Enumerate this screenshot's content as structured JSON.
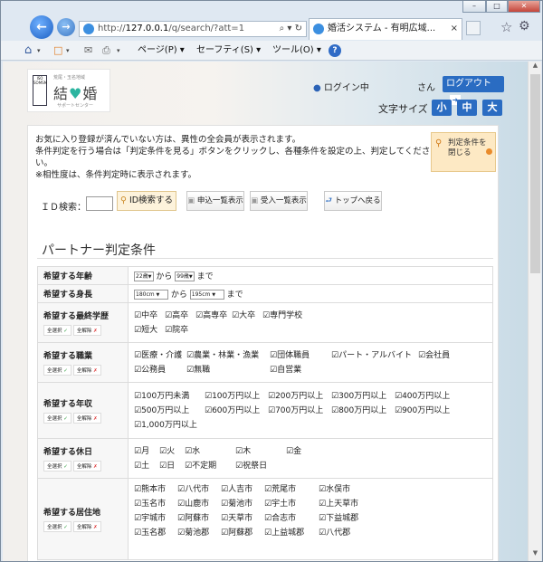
{
  "browser": {
    "url_prefix": "http://",
    "url_host": "127.0.0.1",
    "url_path": "/q/search/?att=1",
    "address_icons": "⌕ ▾ ↻",
    "tab_title": "婚活システム - 有明広域...",
    "tab_close": "×",
    "menu": {
      "page": "ページ(P) ▾",
      "safety": "セーフティ(S) ▾",
      "tools": "ツール(O) ▾",
      "help": "?"
    },
    "window_buttons": {
      "min": "–",
      "max": "□",
      "close": "✕"
    }
  },
  "header": {
    "logo_sub": "荒尾・玉名地域",
    "logo_main_a": "結",
    "logo_main_b": "婚",
    "logo_sub2": "サポートセンター",
    "logo_badge": "ISO SOMSM",
    "login_status": "ログイン中",
    "san": "さん",
    "logout": "ログアウト",
    "font_size_label": "文字サイズ",
    "font_sizes": [
      "小",
      "中",
      "大"
    ]
  },
  "notice": {
    "line1": "お気に入り登録が済んでいない方は、異性の全会員が表示されます。",
    "line2": "条件判定を行う場合は「判定条件を見る」ボタンをクリックし、各種条件を設定の上、判定してくださ",
    "line3": "い。",
    "line4": "※相性度は、条件判定時に表示されます。",
    "judge_button_l1": "判定条件を",
    "judge_button_l2": "閉じる"
  },
  "id_search": {
    "label": "ＩＤ検索：",
    "value": "",
    "search_button": "ID検索する",
    "btn_applied": "申込一覧表示",
    "btn_received": "受入一覧表示",
    "btn_top": "トップへ戻る"
  },
  "section_title": "パートナー判定条件",
  "select_all": "全選択",
  "deselect_all": "全解除",
  "rows": {
    "age": {
      "label": "希望する年齢",
      "from": "22歳",
      "kara": "から",
      "to": "99歳",
      "made": "まで"
    },
    "height": {
      "label": "希望する身長",
      "from": "180cm",
      "kara": "から",
      "to": "195cm",
      "made": "まで"
    },
    "education": {
      "label": "希望する最終学歴",
      "options": [
        "中卒",
        "高卒",
        "高専卒",
        "大卒",
        "専門学校",
        "短大",
        "院卒"
      ]
    },
    "job": {
      "label": "希望する職業",
      "options": [
        "医療・介護",
        "農業・林業・漁業",
        "団体職員",
        "パート・アルバイト",
        "会社員",
        "公務員",
        "無職",
        "自営業"
      ]
    },
    "income": {
      "label": "希望する年収",
      "options": [
        "100万円未満",
        "100万円以上",
        "200万円以上",
        "300万円以上",
        "400万円以上",
        "500万円以上",
        "600万円以上",
        "700万円以上",
        "800万円以上",
        "900万円以上",
        "1,000万円以上"
      ]
    },
    "holiday": {
      "label": "希望する休日",
      "options": [
        "月",
        "火",
        "水",
        "木",
        "金",
        "土",
        "日",
        "不定期",
        "祝祭日"
      ]
    },
    "residence": {
      "label": "希望する居住地",
      "options": [
        "熊本市",
        "八代市",
        "人吉市",
        "荒尾市",
        "水俣市",
        "玉名市",
        "山鹿市",
        "菊池市",
        "宇土市",
        "上天草市",
        "宇城市",
        "阿蘇市",
        "天草市",
        "合志市",
        "下益城郡",
        "玉名郡",
        "菊池郡",
        "阿蘇郡",
        "上益城郡",
        "八代郡"
      ]
    }
  }
}
